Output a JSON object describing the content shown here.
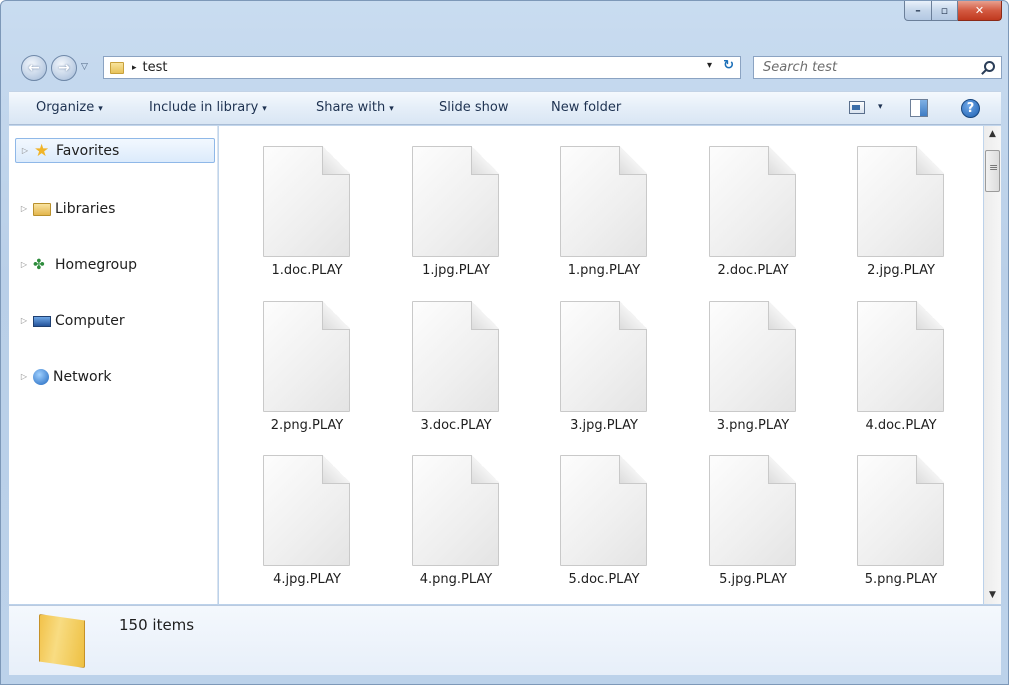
{
  "window": {
    "title": "test"
  },
  "caption": {
    "minimize": "–",
    "maximize": "▫",
    "close": "✕"
  },
  "address": {
    "path": "test",
    "separator": "▸",
    "dropdown": "▾",
    "refresh": "↻"
  },
  "search": {
    "placeholder": "Search test"
  },
  "commandbar": {
    "organize": "Organize",
    "include_library": "Include in library",
    "share_with": "Share with",
    "slide_show": "Slide show",
    "new_folder": "New folder",
    "dropdown_caret": "▾"
  },
  "navpane": {
    "items": [
      {
        "label": "Favorites",
        "icon": "star-icon",
        "selected": true
      },
      {
        "label": "Libraries",
        "icon": "libraries-icon"
      },
      {
        "label": "Homegroup",
        "icon": "homegroup-icon"
      },
      {
        "label": "Computer",
        "icon": "computer-icon"
      },
      {
        "label": "Network",
        "icon": "network-icon"
      }
    ]
  },
  "files": [
    "1.doc.PLAY",
    "1.jpg.PLAY",
    "1.png.PLAY",
    "2.doc.PLAY",
    "2.jpg.PLAY",
    "2.png.PLAY",
    "3.doc.PLAY",
    "3.jpg.PLAY",
    "3.png.PLAY",
    "4.doc.PLAY",
    "4.jpg.PLAY",
    "4.png.PLAY",
    "5.doc.PLAY",
    "5.jpg.PLAY",
    "5.png.PLAY"
  ],
  "details": {
    "item_count": "150 items"
  },
  "colors": {
    "chrome": "#c9dcf0",
    "selection": "#dcebfc",
    "close_button": "#c0391f"
  }
}
